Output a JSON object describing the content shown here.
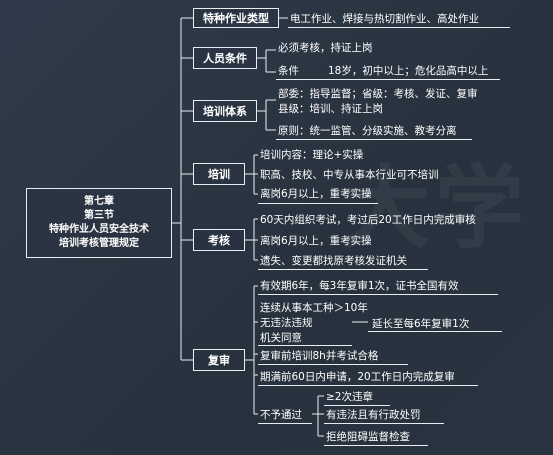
{
  "root": {
    "line1": "第七章",
    "line2": "第三节",
    "line3": "特种作业人员安全技术",
    "line4": "培训考核管理规定"
  },
  "watermark": "大学",
  "branches": {
    "types": {
      "label": "特种作业类型",
      "items": [
        "电工作业、焊接与热切割作业、高处作业"
      ]
    },
    "conditions": {
      "label": "人员条件",
      "items": [
        "必须考核，持证上岗",
        "条件",
        "18岁，初中以上；危化品高中以上"
      ]
    },
    "system": {
      "label": "培训体系",
      "items": [
        "部委：指导监督；省级：考核、发证、复审",
        "县级：培训、持证上岗",
        "原则：统一监管、分级实施、教考分离"
      ]
    },
    "training": {
      "label": "培训",
      "items": [
        "培训内容：理论+实操",
        "职高、技校、中专从事本行业可不培训",
        "离岗6月以上，重考实操"
      ]
    },
    "exam": {
      "label": "考核",
      "items": [
        "60天内组织考试，考过后20工作日内完成审核",
        "离岗6月以上，重考实操",
        "遗失、变更都找原考核发证机关"
      ]
    },
    "review": {
      "label": "复审",
      "items": [
        "有效期6年，每3年复审1次，证书全国有效",
        "连续从事本工种＞10年",
        "无违法违规",
        "机关同意",
        "延长至每6年复审1次",
        "复审前培训8h并考试合格",
        "期满前60日内申请，20工作日内完成复审",
        "不予通过",
        "≥2次违章",
        "有违法且有行政处罚",
        "拒绝阻碍监督检查"
      ]
    }
  }
}
